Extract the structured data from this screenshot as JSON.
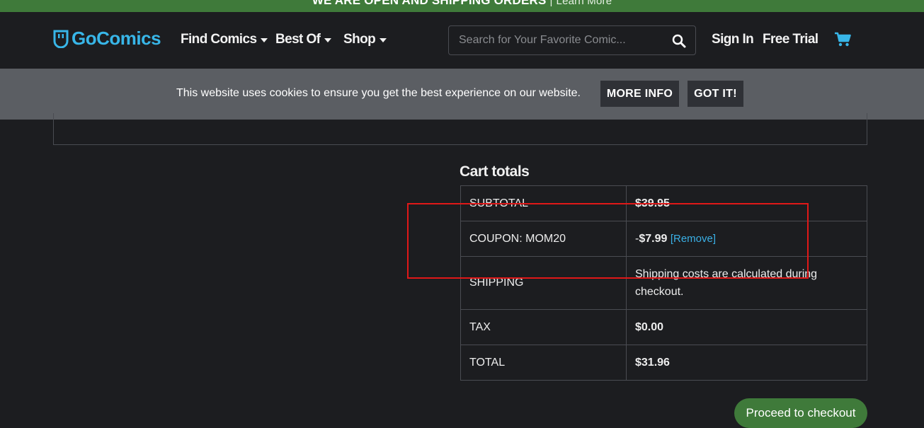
{
  "announcement": {
    "message": "WE ARE OPEN AND SHIPPING ORDERS",
    "separator": "|",
    "link": "Learn More"
  },
  "header": {
    "logo_text": "GoComics",
    "nav": [
      {
        "label": "Find Comics"
      },
      {
        "label": "Best Of"
      },
      {
        "label": "Shop"
      }
    ],
    "search_placeholder": "Search for Your Favorite Comic...",
    "sign_in": "Sign In",
    "free_trial": "Free Trial"
  },
  "cookie_banner": {
    "text": "This website uses cookies to ensure you get the best experience on our website.",
    "more_info": "MORE INFO",
    "got_it": "GOT IT!"
  },
  "cart_totals": {
    "title": "Cart totals",
    "subtotal_label": "SUBTOTAL",
    "subtotal_value": "$39.95",
    "coupon_label": "COUPON: MOM20",
    "coupon_prefix": "-",
    "coupon_value": "$7.99",
    "coupon_remove": "[Remove]",
    "shipping_label": "SHIPPING",
    "shipping_value": "Shipping costs are calculated during checkout.",
    "tax_label": "TAX",
    "tax_value": "$0.00",
    "total_label": "TOTAL",
    "total_value": "$31.96"
  },
  "checkout_button": "Proceed to checkout",
  "colors": {
    "brand_green": "#3f7a3a",
    "brand_blue": "#38b6e8",
    "highlight_red": "#e01818"
  }
}
